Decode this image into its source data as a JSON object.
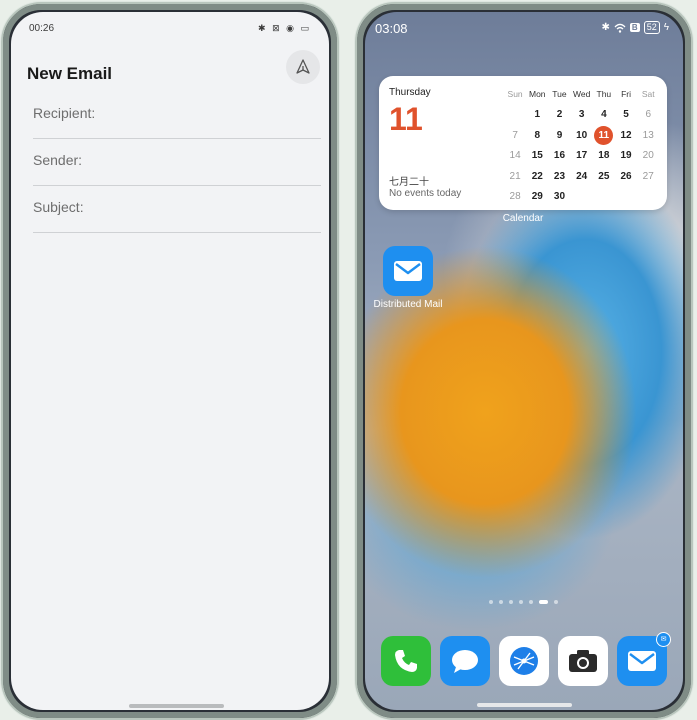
{
  "left": {
    "status_time": "00:26",
    "status_icons": "✱ ⊠ ◉ ▭",
    "title": "New Email",
    "send_icon": "send-icon",
    "fields": {
      "recipient": "Recipient:",
      "sender": "Sender:",
      "subject": "Subject:"
    }
  },
  "right": {
    "status_time": "03:08",
    "status_icons": [
      "bluetooth-icon",
      "wifi-icon",
      "b-icon"
    ],
    "battery": "52",
    "widget": {
      "weekday": "Thursday",
      "date": "11",
      "lunar": "七月二十",
      "events": "No events today",
      "label": "Calendar",
      "headers": [
        "Sun",
        "Mon",
        "Tue",
        "Wed",
        "Thu",
        "Fri",
        "Sat"
      ],
      "weeks": [
        [
          "",
          "1",
          "2",
          "3",
          "4",
          "5",
          "6"
        ],
        [
          "7",
          "8",
          "9",
          "10",
          "11",
          "12",
          "13"
        ],
        [
          "14",
          "15",
          "16",
          "17",
          "18",
          "19",
          "20"
        ],
        [
          "21",
          "22",
          "23",
          "24",
          "25",
          "26",
          "27"
        ],
        [
          "28",
          "29",
          "30",
          "",
          "",
          "",
          ""
        ]
      ],
      "today": "11"
    },
    "app": {
      "label": "Distributed Mail",
      "icon": "mail-icon"
    },
    "page_indicator": {
      "count": 7,
      "active": 6
    },
    "dock": [
      {
        "name": "phone",
        "icon": "phone-icon",
        "color": "#2fbf3a"
      },
      {
        "name": "messages",
        "icon": "message-icon",
        "color": "#1e8ff0"
      },
      {
        "name": "browser",
        "icon": "browser-icon",
        "color": "#ffffff"
      },
      {
        "name": "camera",
        "icon": "camera-icon",
        "color": "#ffffff"
      },
      {
        "name": "mail",
        "icon": "mail-icon",
        "color": "#1e8ff0",
        "badge": ""
      }
    ]
  },
  "colors": {
    "accent_red": "#e0522c",
    "mail_blue": "#1e8ff0"
  }
}
